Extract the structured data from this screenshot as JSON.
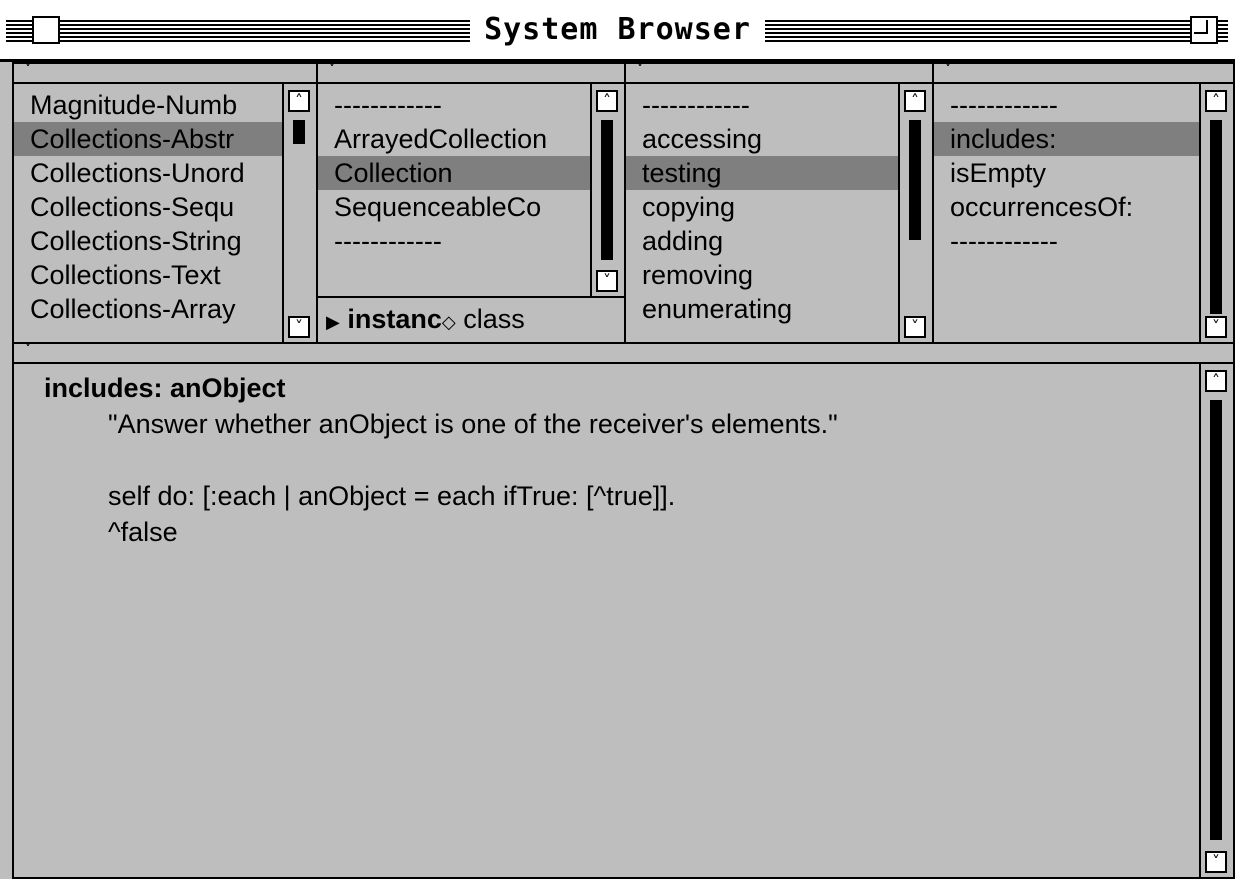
{
  "window": {
    "title": "System Browser"
  },
  "categories": {
    "items": [
      "Magnitude-Numb",
      "Collections-Abstr",
      "Collections-Unord",
      "Collections-Sequ",
      "Collections-String",
      "Collections-Text",
      "Collections-Array"
    ],
    "selected": "Collections-Abstr"
  },
  "classes": {
    "items": [
      "------------",
      "ArrayedCollection",
      "Collection",
      "SequenceableCo",
      "------------"
    ],
    "selected": "Collection",
    "toggle_instance": "instanc",
    "toggle_class": "class"
  },
  "protocols": {
    "items": [
      "------------",
      "accessing",
      "testing",
      "copying",
      "adding",
      "removing",
      "enumerating"
    ],
    "selected": "testing"
  },
  "methods": {
    "items": [
      "------------",
      "includes:",
      "isEmpty",
      "occurrencesOf:",
      "------------"
    ],
    "selected": "includes:"
  },
  "code": {
    "signature": "includes: anObject",
    "comment": "\"Answer whether anObject is one of the receiver's elements.\"",
    "blank": "",
    "line1": "self do: [:each | anObject = each ifTrue: [^true]].",
    "line2": "^false"
  }
}
